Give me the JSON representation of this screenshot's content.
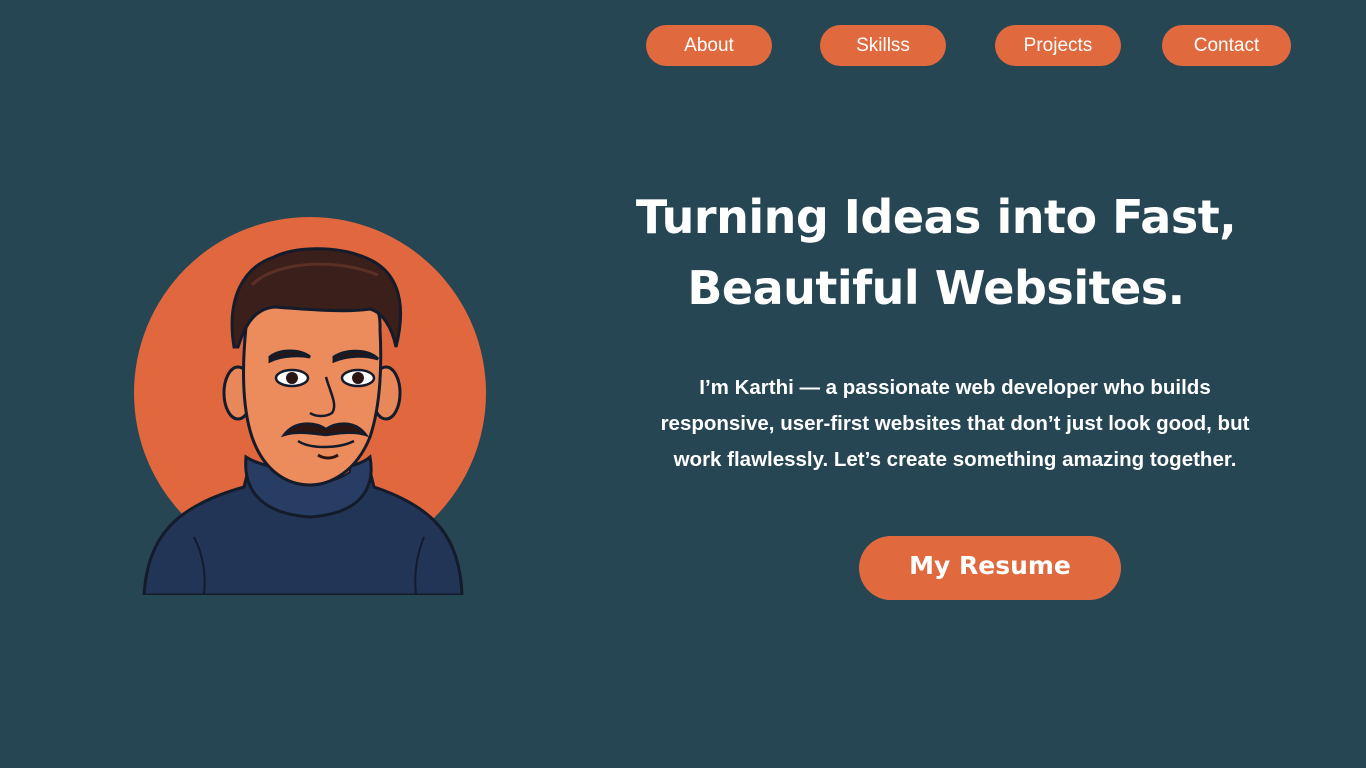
{
  "nav": {
    "items": [
      {
        "label": "About"
      },
      {
        "label": "Skillss"
      },
      {
        "label": "Projects"
      },
      {
        "label": "Contact"
      }
    ]
  },
  "hero": {
    "headline_line1": "Turning Ideas into Fast,",
    "headline_line2": "Beautiful Websites.",
    "intro_line1": "I’m Karthi — a passionate web developer who builds",
    "intro_line2": "responsive, user-first websites that don’t just look good, but",
    "intro_line3": "work flawlessly. Let’s create something amazing together.",
    "resume_label": "My Resume"
  },
  "avatar": {
    "icon": "developer-avatar-illustration"
  },
  "colors": {
    "background": "#264653",
    "accent": "#e06a3e",
    "text": "#ffffff"
  }
}
